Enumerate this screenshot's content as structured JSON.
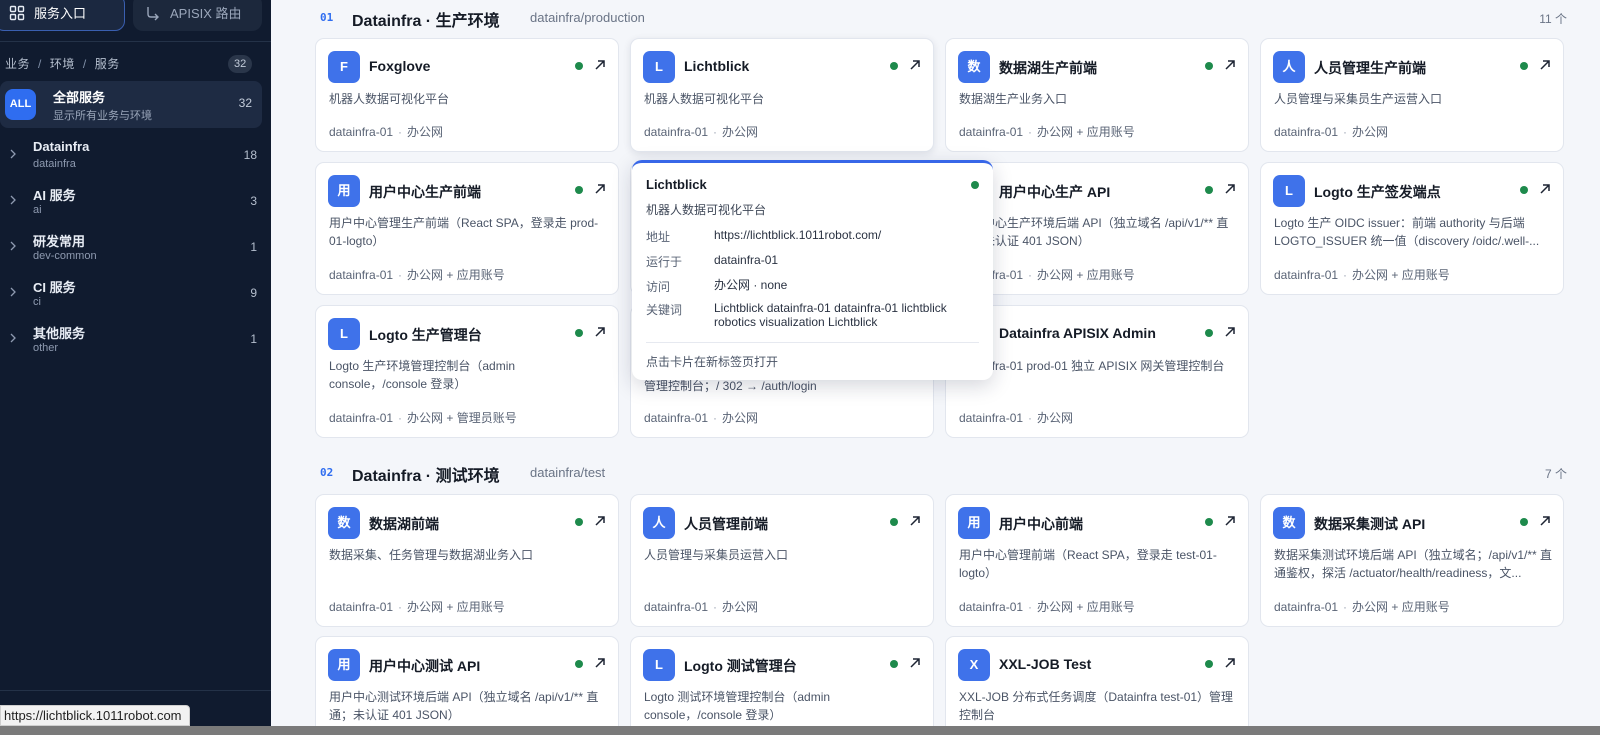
{
  "sidebar": {
    "tabs": [
      {
        "label": "服务入口",
        "icon": "grid-icon"
      },
      {
        "label": "APISIX 路由",
        "icon": "route-icon"
      }
    ],
    "breadcrumb": [
      "业务",
      "环境",
      "服务"
    ],
    "total": "32",
    "all": {
      "badge": "ALL",
      "title": "全部服务",
      "subtitle": "显示所有业务与环境",
      "count": "32"
    },
    "groups": [
      {
        "title": "Datainfra",
        "subtitle": "datainfra",
        "count": "18"
      },
      {
        "title": "AI 服务",
        "subtitle": "ai",
        "count": "3"
      },
      {
        "title": "研发常用",
        "subtitle": "dev-common",
        "count": "1"
      },
      {
        "title": "CI 服务",
        "subtitle": "ci",
        "count": "9"
      },
      {
        "title": "其他服务",
        "subtitle": "other",
        "count": "1"
      }
    ]
  },
  "status_url": "https://lichtblick.1011robot.com",
  "sections": [
    {
      "num": "01",
      "title": "Datainfra · 生产环境",
      "path": "datainfra/production",
      "count": "11 个",
      "cards": [
        {
          "badge": "F",
          "title": "Foxglove",
          "desc": "机器人数据可视化平台",
          "host": "datainfra-01",
          "access": "办公网"
        },
        {
          "badge": "L",
          "title": "Lichtblick",
          "desc": "机器人数据可视化平台",
          "host": "datainfra-01",
          "access": "办公网"
        },
        {
          "badge": "数",
          "title": "数据湖生产前端",
          "desc": "数据湖生产业务入口",
          "host": "datainfra-01",
          "access": "办公网 + 应用账号"
        },
        {
          "badge": "人",
          "title": "人员管理生产前端",
          "desc": "人员管理与采集员生产运营入口",
          "host": "datainfra-01",
          "access": "办公网"
        },
        {
          "badge": "用",
          "title": "用户中心生产前端",
          "desc": "用户中心管理生产前端（React SPA，登录走 prod-01-logto）",
          "host": "datainfra-01",
          "access": "办公网 + 应用账号"
        },
        {
          "badge": "",
          "title": "",
          "desc": "",
          "host": "",
          "access": ""
        },
        {
          "badge": "用",
          "title": "用户中心生产 API",
          "desc": "用户中心生产环境后端 API（独立域名 /api/v1/** 直通；未认证 401 JSON）",
          "host": "datainfra-01",
          "access": "办公网 + 应用账号"
        },
        {
          "badge": "L",
          "title": "Logto 生产签发端点",
          "desc": "Logto 生产 OIDC issuer：前端 authority 与后端 LOGTO_ISSUER 统一值（discovery /oidc/.well-...",
          "host": "datainfra-01",
          "access": "办公网 + 应用账号"
        },
        {
          "badge": "L",
          "title": "Logto 生产管理台",
          "desc": "Logto 生产环境管理控制台（admin console，/console 登录）",
          "host": "datainfra-01",
          "access": "办公网 + 管理员账号"
        },
        {
          "badge": "",
          "title": "",
          "desc": "管理控制台；/ 302 → /auth/login",
          "host": "datainfra-01",
          "access": "办公网"
        },
        {
          "badge": "D",
          "title": "Datainfra APISIX Admin",
          "desc": "datainfra-01 prod-01 独立 APISIX 网关管理控制台",
          "host": "datainfra-01",
          "access": "办公网"
        }
      ]
    },
    {
      "num": "02",
      "title": "Datainfra · 测试环境",
      "path": "datainfra/test",
      "count": "7 个",
      "cards": [
        {
          "badge": "数",
          "title": "数据湖前端",
          "desc": "数据采集、任务管理与数据湖业务入口",
          "host": "datainfra-01",
          "access": "办公网 + 应用账号"
        },
        {
          "badge": "人",
          "title": "人员管理前端",
          "desc": "人员管理与采集员运营入口",
          "host": "datainfra-01",
          "access": "办公网"
        },
        {
          "badge": "用",
          "title": "用户中心前端",
          "desc": "用户中心管理前端（React SPA，登录走 test-01-logto）",
          "host": "datainfra-01",
          "access": "办公网 + 应用账号"
        },
        {
          "badge": "数",
          "title": "数据采集测试 API",
          "desc": "数据采集测试环境后端 API（独立域名；/api/v1/** 直通鉴权，探活 /actuator/health/readiness，文...",
          "host": "datainfra-01",
          "access": "办公网 + 应用账号"
        },
        {
          "badge": "用",
          "title": "用户中心测试 API",
          "desc": "用户中心测试环境后端 API（独立域名 /api/v1/** 直通；未认证 401 JSON）",
          "host": "",
          "access": ""
        },
        {
          "badge": "L",
          "title": "Logto 测试管理台",
          "desc": "Logto 测试环境管理控制台（admin console，/console 登录）",
          "host": "",
          "access": ""
        },
        {
          "badge": "X",
          "title": "XXL-JOB Test",
          "desc": "XXL-JOB 分布式任务调度（Datainfra test-01）管理控制台",
          "host": "",
          "access": ""
        }
      ]
    }
  ],
  "tooltip": {
    "title": "Lichtblick",
    "desc": "机器人数据可视化平台",
    "rows": [
      {
        "key": "地址",
        "value": "https://lichtblick.1011robot.com/"
      },
      {
        "key": "运行于",
        "value": "datainfra-01"
      },
      {
        "key": "访问",
        "value": "办公网 · none"
      },
      {
        "key": "关键词",
        "value": "Lichtblick datainfra-01 datainfra-01 lichtblick robotics visualization Lichtblick"
      }
    ],
    "hint": "点击卡片在新标签页打开"
  },
  "colors": {
    "accent": "#3f72ea",
    "status_ok": "#1e8a4c",
    "sidebar_bg": "#101b2f"
  }
}
